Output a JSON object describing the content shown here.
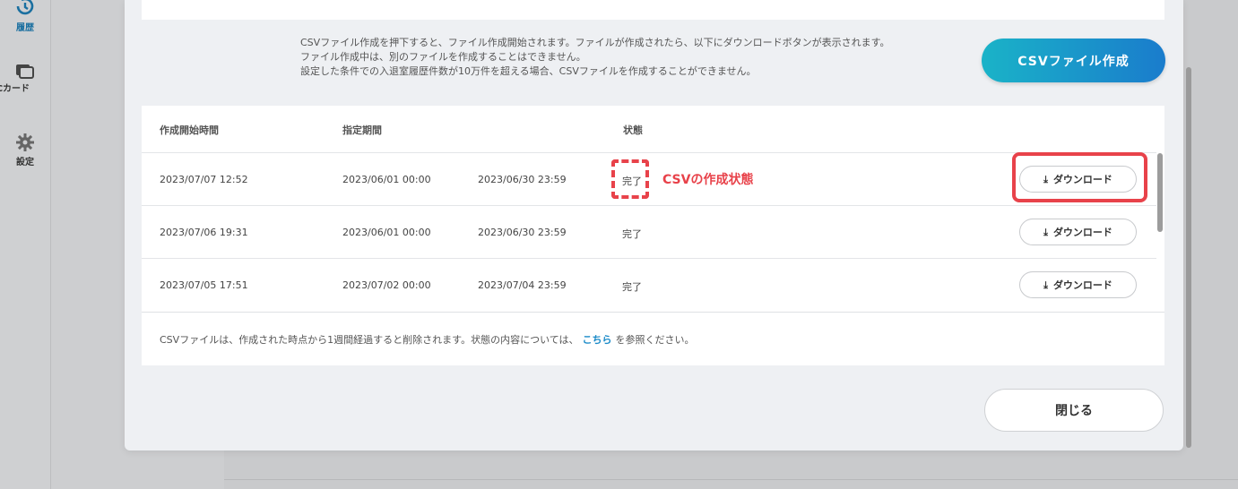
{
  "nav": {
    "items": [
      {
        "label": "履歴",
        "icon": "history-icon"
      },
      {
        "label": "ICカード",
        "icon": "card-icon"
      },
      {
        "label": "設定",
        "icon": "gear-icon"
      }
    ]
  },
  "notice": {
    "lines": [
      "CSVファイル作成を押下すると、ファイル作成開始されます。ファイルが作成されたら、以下にダウンロードボタンが表示されます。",
      "ファイル作成中は、別のファイルを作成することはできません。",
      "設定した条件での入退室履歴件数が10万件を超える場合、CSVファイルを作成することができません。"
    ]
  },
  "create_button": "CSVファイル作成",
  "table": {
    "headers": [
      "作成開始時間",
      "指定期間",
      "状態"
    ],
    "rows": [
      {
        "created": "2023/07/07 12:52",
        "from": "2023/06/01 00:00",
        "to": "2023/06/30 23:59",
        "status": "完了",
        "action": "ダウンロード"
      },
      {
        "created": "2023/07/06 19:31",
        "from": "2023/06/01 00:00",
        "to": "2023/06/30 23:59",
        "status": "完了",
        "action": "ダウンロード"
      },
      {
        "created": "2023/07/05 17:51",
        "from": "2023/07/02 00:00",
        "to": "2023/07/04 23:59",
        "status": "完了",
        "action": "ダウンロード"
      }
    ],
    "footer": {
      "before": "CSVファイルは、作成された時点から1週間経過すると削除されます。状態の内容については、",
      "link": "こちら",
      "after": "を参照ください。"
    }
  },
  "annotation": {
    "label": "CSVの作成状態",
    "color": "#e8424a"
  },
  "close_button": "閉じる",
  "colors": {
    "accent_start": "#1ab3c8",
    "accent_end": "#1a7ccc",
    "link": "#1a8ac8"
  }
}
